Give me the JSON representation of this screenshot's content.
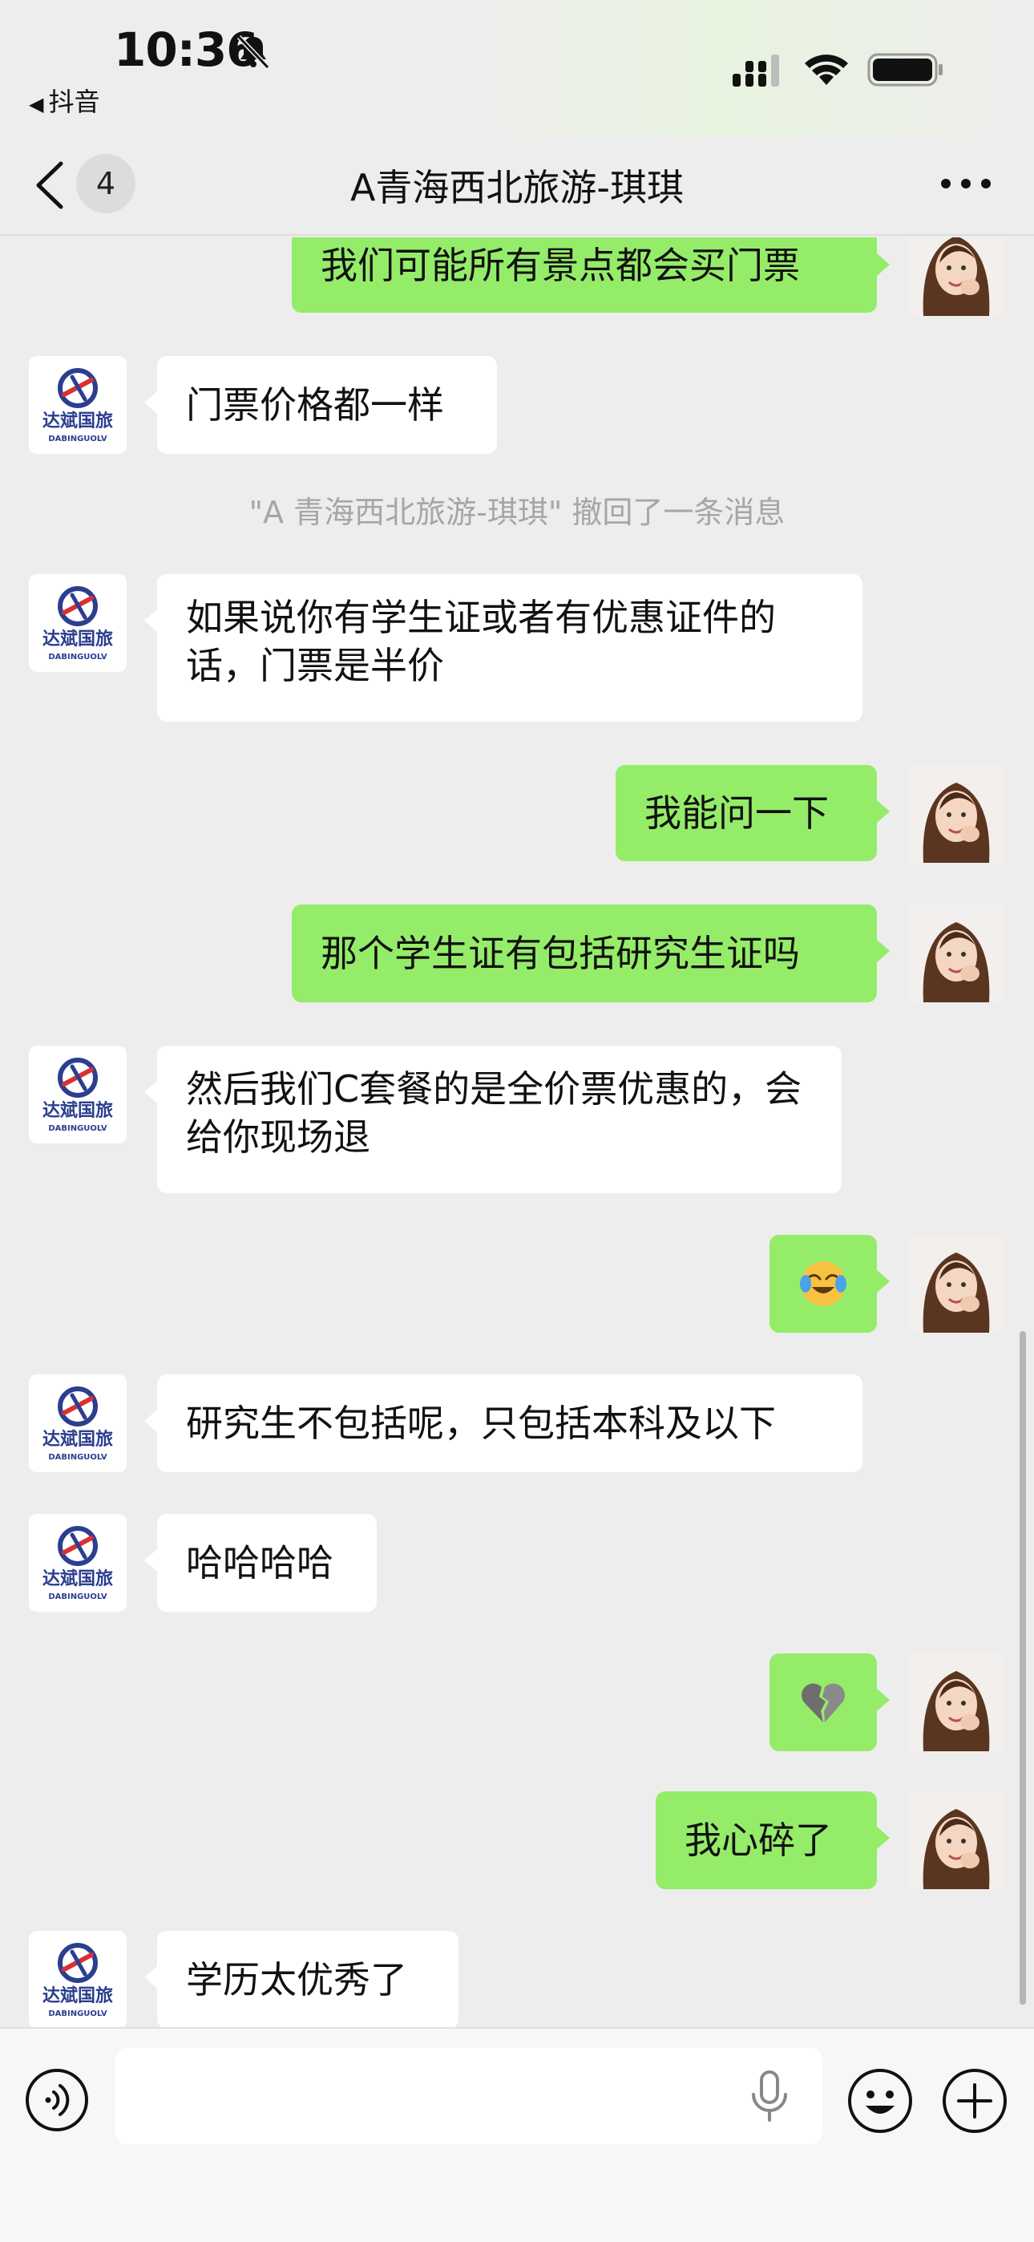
{
  "status_bar": {
    "time": "10:36",
    "back_app": "抖音"
  },
  "nav": {
    "unread_count": "4",
    "title": "A青海西北旅游-琪琪"
  },
  "contact_logo": {
    "brand": "达斌国旅",
    "brand_en": "DABINGUOLV"
  },
  "messages": [
    {
      "side": "out",
      "text": "我们可能所有景点都会买门票"
    },
    {
      "side": "in",
      "text": "门票价格都一样"
    },
    {
      "side": "system",
      "text": "\"A 青海西北旅游-琪琪\" 撤回了一条消息"
    },
    {
      "side": "in",
      "text": "如果说你有学生证或者有优惠证件的话，门票是半价"
    },
    {
      "side": "out",
      "text": "我能问一下"
    },
    {
      "side": "out",
      "text": "那个学生证有包括研究生证吗"
    },
    {
      "side": "in",
      "text": "然后我们C套餐的是全价票优惠的，会给你现场退"
    },
    {
      "side": "out",
      "emoji": "crying-laughing-emoji"
    },
    {
      "side": "in",
      "text": "研究生不包括呢，只包括本科及以下"
    },
    {
      "side": "in",
      "text": "哈哈哈哈"
    },
    {
      "side": "out",
      "emoji": "broken-heart-emoji"
    },
    {
      "side": "out",
      "text": "我心碎了"
    },
    {
      "side": "in",
      "text": "学历太优秀了"
    }
  ],
  "colors": {
    "outgoing_bubble": "#95ec69",
    "incoming_bubble": "#ffffff",
    "background": "#ededed"
  }
}
